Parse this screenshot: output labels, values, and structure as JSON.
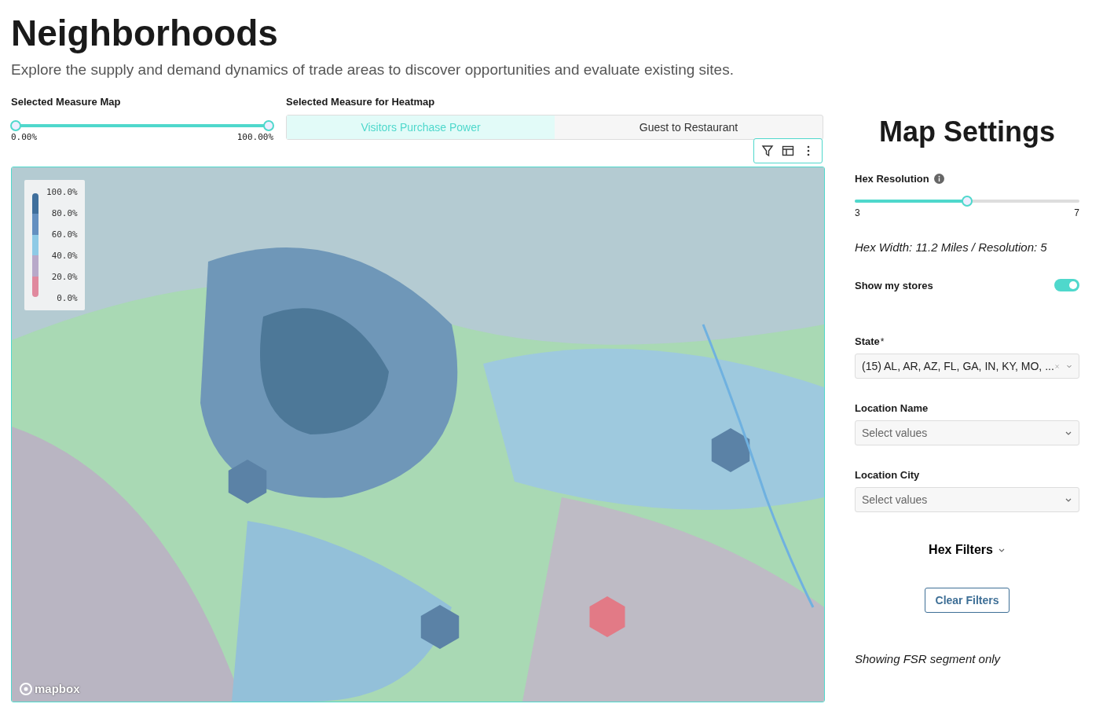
{
  "header": {
    "title": "Neighborhoods",
    "subtitle": "Explore the supply and demand dynamics of trade areas to discover opportunities and evaluate existing sites."
  },
  "measure_map": {
    "label": "Selected Measure Map",
    "level": 1,
    "min_label": "0.00%",
    "max_label": "100.00%"
  },
  "heatmap": {
    "label": "Selected Measure for Heatmap",
    "options": [
      {
        "label": "Visitors Purchase Power",
        "selected": true
      },
      {
        "label": "Guest to Restaurant",
        "selected": false
      }
    ]
  },
  "map": {
    "legend": [
      "100.0%",
      "80.0%",
      "60.0%",
      "40.0%",
      "20.0%",
      "0.0%"
    ],
    "scale": [
      {
        "color": "#3f6f9c"
      },
      {
        "color": "#6490c0"
      },
      {
        "color": "#8ecae6"
      },
      {
        "color": "#b8a9c9"
      },
      {
        "color": "#e0899e"
      }
    ],
    "attribution": "mapbox"
  },
  "settings": {
    "title": "Map Settings",
    "hex_resolution": {
      "label": "Hex Resolution",
      "level": 0.5,
      "min_label": "3",
      "max_label": "7"
    },
    "hex_info": "Hex Width: 11.2 Miles / Resolution: 5",
    "show_stores": {
      "label": "Show my stores",
      "on": true
    },
    "fields": [
      {
        "label": "State",
        "required_mark": "*",
        "value": "(15) AL, AR, AZ, FL, GA, IN, KY, MO, ...",
        "clearable": true
      },
      {
        "label": "Location Name",
        "placeholder": "Select values",
        "clearable": false
      },
      {
        "label": "Location City",
        "placeholder": "Select values",
        "clearable": false
      }
    ],
    "hex_filters": "Hex Filters",
    "clear_button": "Clear Filters",
    "note": "Showing FSR segment only"
  }
}
